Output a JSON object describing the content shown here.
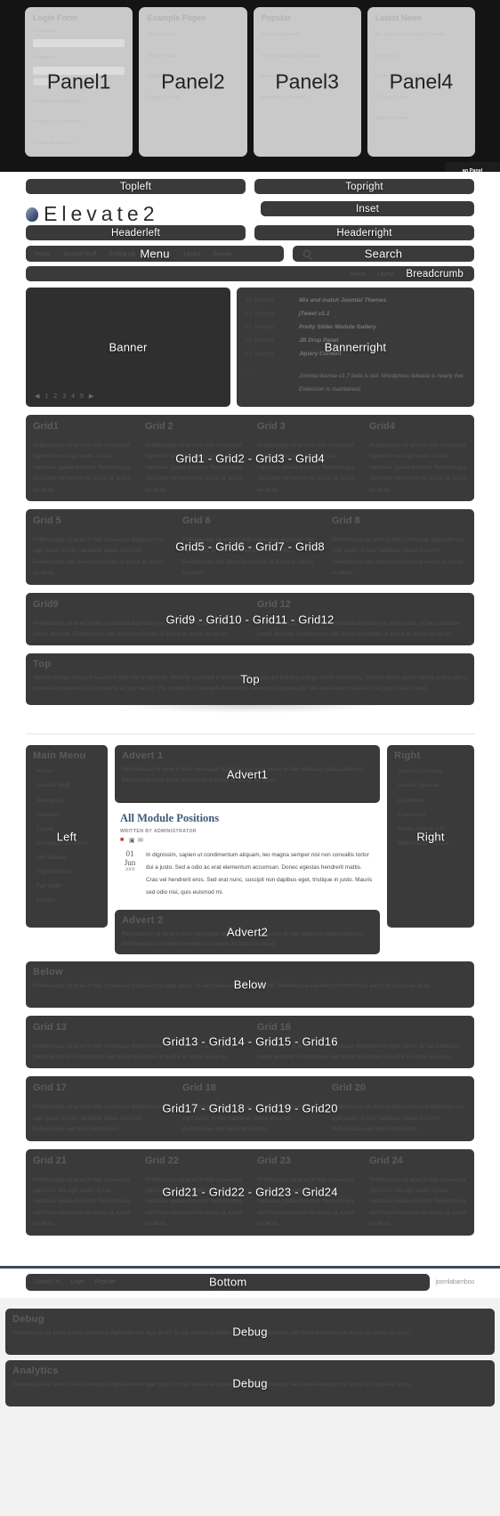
{
  "panels": {
    "overlay_labels": [
      "Panel1",
      "Panel2",
      "Panel3",
      "Panel4"
    ],
    "an_panel_label": "an Panel",
    "cards": [
      {
        "title": "Login Form",
        "fields": [
          {
            "label": "Username"
          },
          {
            "label": "Password"
          }
        ],
        "button": "Login",
        "links": [
          "Forgot your password?",
          "Forgot your username?",
          "Create an account"
        ]
      },
      {
        "title": "Example Pages",
        "links": [
          "Section Blog",
          "Section Table",
          "Category Blog",
          "Category Table"
        ]
      },
      {
        "title": "Popular",
        "links": [
          "Joomla! Overview",
          "Joomla! License Guidelines",
          "Extensions",
          "Welcome to Joomla!"
        ]
      },
      {
        "title": "Latest News",
        "links": [
          "Mix and match Joomla! Themes",
          "jTweet v1.1",
          "Pretty Slider Module Gallery",
          "JB Drop Panel",
          "Jquery Content"
        ]
      }
    ]
  },
  "positions": {
    "topleft": "Topleft",
    "topright": "Topright",
    "inset": "Inset",
    "headerleft": "Headerleft",
    "headerright": "Headerright",
    "menu": "Menu",
    "search": "Search",
    "breadcrumb": "Breadcrumb",
    "banner": "Banner",
    "bannerright": "Bannerright",
    "grid_row1": "Grid1 - Grid2 - Grid3 - Grid4",
    "grid_row2": "Grid5 - Grid6 - Grid7 - Grid8",
    "grid_row3": "Grid9 - Grid10 - Grid11 - Grid12",
    "top": "Top",
    "left": "Left",
    "right": "Right",
    "advert1": "Advert1",
    "advert2": "Advert2",
    "below": "Below",
    "grid_row4": "Grid13 - Grid14 - Grid15 - Grid16",
    "grid_row5": "Grid17 - Grid18 - Grid19 - Grid20",
    "grid_row6": "Grid21 - Grid22 - Grid23 - Grid24",
    "bottom": "Bottom",
    "debug": "Debug",
    "analytics": "Debug"
  },
  "logo": {
    "text": "Elevate2"
  },
  "menu": {
    "items": [
      "Home",
      "Joomla! Stuff",
      "Setting Up",
      "Features",
      "Layout",
      "Elevate"
    ]
  },
  "breadcrumb": {
    "items": [
      "Home",
      "Layout"
    ]
  },
  "bannerright": {
    "rows": [
      {
        "date": "01 January",
        "title": "Mix and match Joomla! Themes"
      },
      {
        "date": "01 January",
        "title": "jTweet v1.1"
      },
      {
        "date": "01 January",
        "title": "Pretty Slider Module Gallery"
      },
      {
        "date": "01 January",
        "title": "JB Drop Panel"
      },
      {
        "date": "01 January",
        "title": "Jquery Content"
      }
    ],
    "note": "Joomla license v1.7 beta is out. Wordpress release is nearly live. Extension is maintained."
  },
  "grids": {
    "row1": [
      {
        "title": "Grid1",
        "body": "Pellentesque sit amet in felis consequat dignissim nec eget quam. In hac habitasse platea dictumst. Pellentesque sed libero fermentum id auctor id, luctus eu lacus."
      },
      {
        "title": "Grid 2",
        "body": "Pellentesque sit amet in felis consequat dignissim nec eget quam. In hac habitasse platea dictumst. Pellentesque sed libero fermentum id auctor id, luctus eu lacus."
      },
      {
        "title": "Grid 3",
        "body": "Pellentesque sit amet in felis consequat dignissim nec eget quam. In hac habitasse platea dictumst. Pellentesque sed libero fermentum id auctor id, luctus eu lacus."
      },
      {
        "title": "Grid4",
        "body": "Pellentesque sit amet in felis consequat dignissim nec eget quam. In hac habitasse platea dictumst. Pellentesque sed libero fermentum id auctor id, luctus eu lacus."
      }
    ],
    "row2": [
      {
        "title": "Grid 5",
        "body": "Pellentesque sit amet in felis consequat dignissim nec eget quam. In hac habitasse platea dictumst. Pellentesque sed libero fermentum id auctor id, luctus eu lacus."
      },
      {
        "title": "Grid 6",
        "body": "Pellentesque sit amet in felis consequat dignissim nec eget quam. In hac habitasse platea dictumst. Pellentesque sed libero fermentum id auctor id, luctus eu lacus."
      },
      {
        "title": "Grid 8",
        "body": "Pellentesque sit amet in felis consequat dignissim nec eget quam. In hac habitasse platea dictumst. Pellentesque sed libero fermentum id auctor id, luctus eu lacus."
      }
    ],
    "row3": [
      {
        "title": "Grid9",
        "body": "Pellentesque sit amet in felis consequat dignissim nec eget quam. In hac habitasse platea dictumst. Pellentesque sed libero fermentum id auctor id, luctus eu lacus."
      },
      {
        "title": "Grid 12",
        "body": "Pellentesque sit amet in felis consequat dignissim nec eget quam. In hac habitasse platea dictumst. Pellentesque sed libero fermentum id auctor id, luctus eu lacus."
      }
    ],
    "row4": [
      {
        "title": "Grid 13",
        "body": "Pellentesque sit amet in felis consequat dignissim nec eget quam. In hac habitasse platea dictumst. Pellentesque sed libero fermentum id auctor id, luctus eu lacus."
      },
      {
        "title": "Grid 16",
        "body": "Pellentesque sit amet in felis consequat dignissim nec eget quam. In hac habitasse platea dictumst. Pellentesque sed libero fermentum id auctor id, luctus eu lacus."
      }
    ],
    "row5": [
      {
        "title": "Grid 17",
        "body": "Pellentesque sit amet in felis consequat dignissim nec eget quam. In hac habitasse platea dictumst. Pellentesque sed libero fermentum."
      },
      {
        "title": "Grid 18",
        "body": "Pellentesque sit amet in felis consequat dignissim nec eget quam. In hac habitasse platea dictumst. Pellentesque sed libero fermentum."
      },
      {
        "title": "Grid 20",
        "body": "Pellentesque sit amet in felis consequat dignissim nec eget quam. In hac habitasse platea dictumst. Pellentesque sed libero fermentum."
      }
    ],
    "row6": [
      {
        "title": "Grid 21",
        "body": "Pellentesque sit amet in felis consequat dignissim nec eget quam. In hac habitasse platea dictumst. Pellentesque sed libero fermentum id auctor id, luctus eu lacus."
      },
      {
        "title": "Grid 22",
        "body": "Pellentesque sit amet in felis consequat dignissim nec eget quam. In hac habitasse platea dictumst. Pellentesque sed libero fermentum id auctor id, luctus eu lacus."
      },
      {
        "title": "Grid 23",
        "body": "Pellentesque sit amet in felis consequat dignissim nec eget quam. In hac habitasse platea dictumst. Pellentesque sed libero fermentum id auctor id, luctus eu lacus."
      },
      {
        "title": "Grid 24",
        "body": "Pellentesque sit amet in felis consequat dignissim nec eget quam. In hac habitasse platea dictumst. Pellentesque sed libero fermentum id auctor id, luctus eu lacus."
      }
    ]
  },
  "top_module": {
    "title": "Top",
    "body": "Joomla! makes it easy to launch a Web site of any kind. Whether you want a brochure site or you are building a large online community, Joomla! allows you to deploy a new site in minutes and add extra functionality as you need it. The hundreds of available Extensions will help to expand your site and delivery services that your visitors need."
  },
  "sidebar_left": {
    "title": "Main Menu",
    "items": [
      "Home",
      "Joomla! Stuff",
      "Setting Up",
      "Features",
      "Layout",
      "All Module Positions",
      "Left Sidebar",
      "Right Sidebar",
      "Full Width",
      "Elevate"
    ]
  },
  "sidebar_right": {
    "title": "Right",
    "items": [
      "Joomla! Overview",
      "Joomla! License Guidelines",
      "Extensions",
      "What's New in 1.5?",
      "Welcome to Joomla!"
    ]
  },
  "advert1": {
    "title": "Advert 1",
    "body": "Pellentesque sit amet in felis consequat dignissim nec eget quam. In hac habitasse platea dictumst. Pellentesque sed libero fermentum id auctor id, luctus eu lacus."
  },
  "advert2": {
    "title": "Advert 2",
    "body": "Pellentesque sit amet in felis consequat dignissim nec eget quam. In hac habitasse platea dictumst. Pellentesque sed libero fermentum id auctor id, luctus eu lacus."
  },
  "article": {
    "title": "All Module Positions",
    "byline": "Written by Administrator",
    "date_day": "01",
    "date_month": "Jun",
    "date_year": "2009",
    "body": "In dignissim, sapien ut condimentum aliquam, leo magna semper nisl non convallis tortor dui a justo. Sed a odio ac erat elementum accumsan. Donec egestas hendrerit mattis. Cras vel hendrerit eros. Sed erat nunc, suscipit non dapibus eget, tristique in justo. Mauris sed odio nisi, quis euismod mi.",
    "icons": [
      "pdf-icon",
      "print-icon",
      "email-icon"
    ]
  },
  "below_module": {
    "title": "Below",
    "body": "Pellentesque sit amet in felis consequat dignissim nec eget quam. In hac habitasse platea dictumst. Pellentesque sed libero fermentum id auctor id, luctus eu lacus."
  },
  "footer": {
    "links": [
      "Contact Us",
      "Login",
      "Register"
    ],
    "brand": "joomlabamboo"
  },
  "debug_modules": [
    {
      "title": "Debug",
      "body": "Pellentesque sit amet in felis consequat dignissim nec eget quam. In hac habitasse platea dictumst. Pellentesque sed libero fermentum id auctor id, luctus eu lacus."
    },
    {
      "title": "Analytics",
      "body": "Pellentesque sit amet in felis consequat dignissim nec eget quam. In hac habitasse platea dictumst. Pellentesque sed libero fermentum id auctor id, luctus eu lacus."
    }
  ],
  "colors": {
    "position_bg": "#3a3a3a",
    "panel_strip_bg": "#141414",
    "panel_card_bg": "#c9c9c9",
    "label_text": "#ffffff",
    "article_heading": "#3c5a78",
    "footer_rule": "#3b4a5e"
  }
}
